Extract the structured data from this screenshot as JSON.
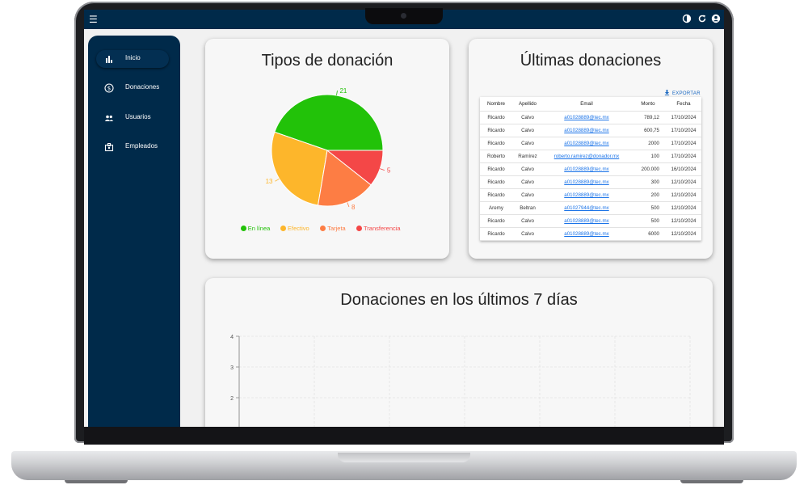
{
  "sidebar": {
    "items": [
      {
        "label": "Inicio",
        "icon": "bar-chart-icon"
      },
      {
        "label": "Donaciones",
        "icon": "dollar-icon"
      },
      {
        "label": "Usuarios",
        "icon": "people-icon"
      },
      {
        "label": "Empleados",
        "icon": "badge-icon"
      }
    ]
  },
  "topbar": {
    "menu_icon": "menu-icon",
    "theme_icon": "contrast-icon",
    "refresh_icon": "refresh-icon",
    "account_icon": "account-icon"
  },
  "pie_card": {
    "title": "Tipos de donación"
  },
  "table_card": {
    "title": "Últimas donaciones",
    "export_label": "EXPORTAR",
    "columns": [
      "Nombre",
      "Apellido",
      "Email",
      "Monto",
      "Fecha"
    ],
    "rows": [
      [
        "Ricardo",
        "Calvo",
        "a01028889@tec.mx",
        "789,12",
        "17/10/2024"
      ],
      [
        "Ricardo",
        "Calvo",
        "a01028889@tec.mx",
        "600,75",
        "17/10/2024"
      ],
      [
        "Ricardo",
        "Calvo",
        "a01028889@tec.mx",
        "2000",
        "17/10/2024"
      ],
      [
        "Roberto",
        "Ramírez",
        "roberto.ramirez@donador.mx",
        "100",
        "17/10/2024"
      ],
      [
        "Ricardo",
        "Calvo",
        "a01028889@tec.mx",
        "200.000",
        "16/10/2024"
      ],
      [
        "Ricardo",
        "Calvo",
        "a01028889@tec.mx",
        "300",
        "12/10/2024"
      ],
      [
        "Ricardo",
        "Calvo",
        "a01028889@tec.mx",
        "200",
        "12/10/2024"
      ],
      [
        "Aremy",
        "Beltran",
        "a01027944@tec.mx",
        "500",
        "12/10/2024"
      ],
      [
        "Ricardo",
        "Calvo",
        "a01028889@tec.mx",
        "500",
        "12/10/2024"
      ],
      [
        "Ricardo",
        "Calvo",
        "a01028889@tec.mx",
        "6000",
        "12/10/2024"
      ]
    ]
  },
  "bar_card": {
    "title": "Donaciones en los últimos 7 días"
  },
  "chart_data": [
    {
      "type": "pie",
      "title": "Tipos de donación",
      "categories": [
        "En línea",
        "Efectivo",
        "Tarjeta",
        "Transferencia"
      ],
      "values": [
        21,
        13,
        8,
        5
      ],
      "colors": [
        "#22c209",
        "#fdb62b",
        "#fd7d44",
        "#f44747"
      ],
      "legend": "bottom"
    },
    {
      "type": "line",
      "title": "Donaciones en los últimos 7 días",
      "y_ticks": [
        "4",
        "3",
        "2"
      ],
      "grid": true
    }
  ]
}
